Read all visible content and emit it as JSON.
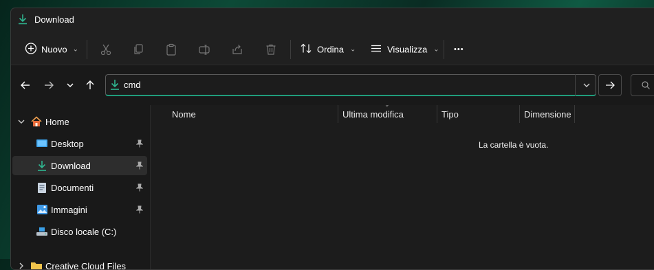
{
  "window": {
    "title": "Download",
    "title_icon": "download-icon",
    "accent": "#1f9d7c"
  },
  "toolbar": {
    "new_label": "Nuovo",
    "sort_label": "Ordina",
    "view_label": "Visualizza",
    "more_label": "•••"
  },
  "address": {
    "value": "cmd",
    "icon": "download-icon"
  },
  "sidebar": {
    "items": [
      {
        "label": "Home",
        "icon": "home-icon"
      },
      {
        "label": "Desktop",
        "icon": "desktop-icon",
        "pinned": true
      },
      {
        "label": "Download",
        "icon": "download-icon",
        "pinned": true,
        "selected": true
      },
      {
        "label": "Documenti",
        "icon": "document-icon",
        "pinned": true
      },
      {
        "label": "Immagini",
        "icon": "pictures-icon",
        "pinned": true
      },
      {
        "label": "Disco locale (C:)",
        "icon": "drive-icon"
      },
      {
        "label": "Creative Cloud Files",
        "icon": "folder-icon"
      }
    ]
  },
  "columns": [
    "Nome",
    "Ultima modifica",
    "Tipo",
    "Dimensione"
  ],
  "empty_message": "La cartella è vuota."
}
